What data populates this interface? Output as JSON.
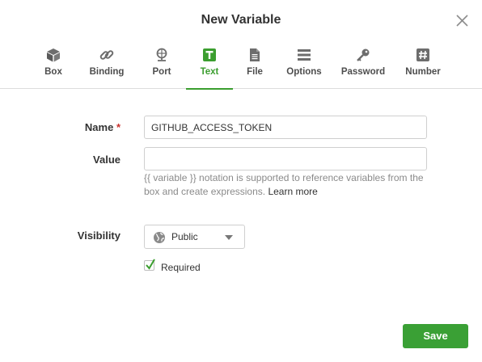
{
  "dialog": {
    "title": "New Variable",
    "close_icon": "close-icon"
  },
  "tabs": [
    {
      "label": "Box",
      "icon": "box-icon",
      "active": false
    },
    {
      "label": "Binding",
      "icon": "link-icon",
      "active": false
    },
    {
      "label": "Port",
      "icon": "port-icon",
      "active": false
    },
    {
      "label": "Text",
      "icon": "text-icon",
      "active": true
    },
    {
      "label": "File",
      "icon": "file-icon",
      "active": false
    },
    {
      "label": "Options",
      "icon": "list-icon",
      "active": false
    },
    {
      "label": "Password",
      "icon": "key-icon",
      "active": false
    },
    {
      "label": "Number",
      "icon": "hash-icon",
      "active": false
    }
  ],
  "form": {
    "name_label": "Name",
    "required_marker": "*",
    "name_value": "GITHUB_ACCESS_TOKEN",
    "value_label": "Value",
    "value_value": "",
    "help_text": "{{ variable }} notation is supported to reference variables from the box and create expressions.",
    "help_link": "Learn more",
    "visibility_label": "Visibility",
    "visibility_value": "Public",
    "required_label": "Required",
    "required_checked": true
  },
  "footer": {
    "save_label": "Save"
  },
  "colors": {
    "accent": "#3b9e2f",
    "save_button": "#3aa035",
    "required_marker": "#c9302c"
  }
}
